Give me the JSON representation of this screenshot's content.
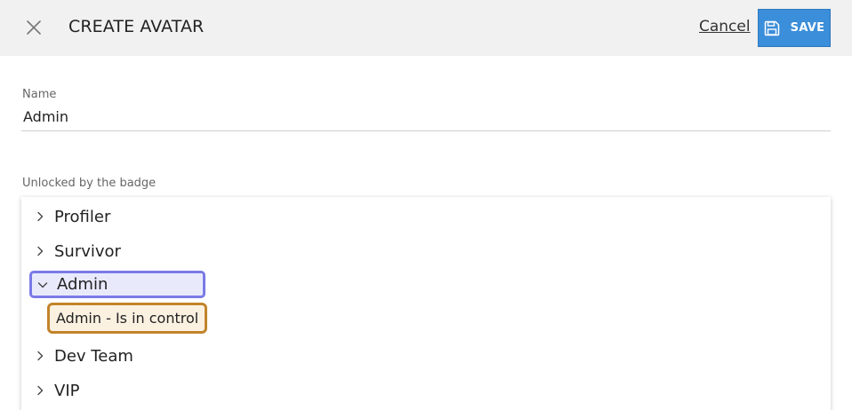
{
  "header": {
    "title": "CREATE AVATAR",
    "cancel_label": "Cancel",
    "save_label": "SAVE"
  },
  "form": {
    "name_label": "Name",
    "name_value": "Admin",
    "badge_label": "Unlocked by the badge"
  },
  "tree": {
    "nodes": [
      {
        "label": "Profiler",
        "expanded": false
      },
      {
        "label": "Survivor",
        "expanded": false
      },
      {
        "label": "Admin",
        "expanded": true,
        "selected": true,
        "children": [
          {
            "label": "Admin - Is in control",
            "selected": true
          }
        ]
      },
      {
        "label": "Dev Team",
        "expanded": false
      },
      {
        "label": "VIP",
        "expanded": false
      }
    ]
  },
  "colors": {
    "header_bg": "#f1f1f1",
    "save_button": "#3b8ed9",
    "selected_node_border": "#7a7ae6",
    "selected_leaf_border": "#c2842a"
  },
  "icons": {
    "close": "close-icon",
    "save": "floppy-disk-icon",
    "collapsed": "chevron-right-icon",
    "expanded": "chevron-down-icon"
  }
}
